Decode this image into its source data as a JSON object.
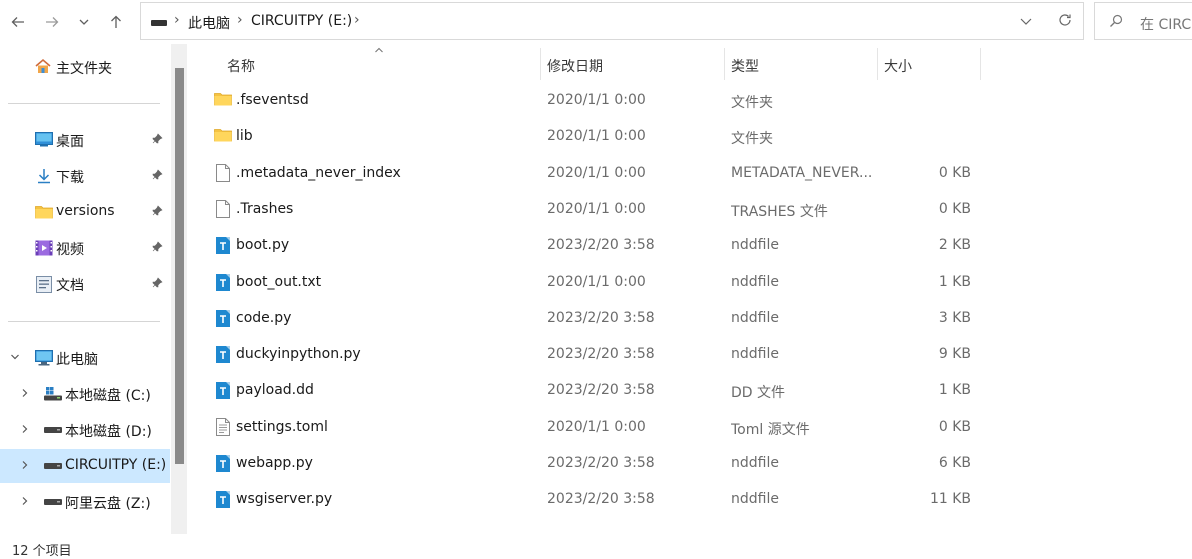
{
  "address": {
    "crumbs": [
      "此电脑",
      "CIRCUITPY (E:)"
    ],
    "separator": "›"
  },
  "search": {
    "placeholder": "在 CIRCUITPY (E:) 中搜索",
    "visible_text": "在 CIRCU"
  },
  "sidebar": {
    "home": "主文件夹",
    "quick_access": [
      {
        "label": "桌面",
        "icon": "desktop-icon"
      },
      {
        "label": "下载",
        "icon": "download-icon"
      },
      {
        "label": "versions",
        "icon": "folder-icon"
      },
      {
        "label": "视频",
        "icon": "video-icon"
      },
      {
        "label": "文档",
        "icon": "document-icon"
      }
    ],
    "this_pc": "此电脑",
    "drives": [
      {
        "label": "本地磁盘 (C:)",
        "icon": "windows-drive-icon"
      },
      {
        "label": "本地磁盘 (D:)",
        "icon": "drive-icon"
      },
      {
        "label": "CIRCUITPY (E:)",
        "icon": "drive-icon",
        "selected": true
      },
      {
        "label": "阿里云盘 (Z:)",
        "icon": "drive-icon"
      }
    ]
  },
  "columns": {
    "name": "名称",
    "date": "修改日期",
    "type": "类型",
    "size": "大小"
  },
  "files": [
    {
      "name": ".fseventsd",
      "date": "2020/1/1 0:00",
      "type": "文件夹",
      "size": "",
      "icon": "folder"
    },
    {
      "name": "lib",
      "date": "2020/1/1 0:00",
      "type": "文件夹",
      "size": "",
      "icon": "folder"
    },
    {
      "name": ".metadata_never_index",
      "date": "2020/1/1 0:00",
      "type": "METADATA_NEVER...",
      "size": "0 KB",
      "icon": "blank"
    },
    {
      "name": ".Trashes",
      "date": "2020/1/1 0:00",
      "type": "TRASHES 文件",
      "size": "0 KB",
      "icon": "blank"
    },
    {
      "name": "boot.py",
      "date": "2023/2/20 3:58",
      "type": "nddfile",
      "size": "2 KB",
      "icon": "ndd"
    },
    {
      "name": "boot_out.txt",
      "date": "2020/1/1 0:00",
      "type": "nddfile",
      "size": "1 KB",
      "icon": "ndd"
    },
    {
      "name": "code.py",
      "date": "2023/2/20 3:58",
      "type": "nddfile",
      "size": "3 KB",
      "icon": "ndd"
    },
    {
      "name": "duckyinpython.py",
      "date": "2023/2/20 3:58",
      "type": "nddfile",
      "size": "9 KB",
      "icon": "ndd"
    },
    {
      "name": "payload.dd",
      "date": "2023/2/20 3:58",
      "type": "DD 文件",
      "size": "1 KB",
      "icon": "ndd"
    },
    {
      "name": "settings.toml",
      "date": "2020/1/1 0:00",
      "type": "Toml 源文件",
      "size": "0 KB",
      "icon": "text"
    },
    {
      "name": "webapp.py",
      "date": "2023/2/20 3:58",
      "type": "nddfile",
      "size": "6 KB",
      "icon": "ndd"
    },
    {
      "name": "wsgiserver.py",
      "date": "2023/2/20 3:58",
      "type": "nddfile",
      "size": "11 KB",
      "icon": "ndd"
    }
  ],
  "status": {
    "item_count": "12 个项目"
  },
  "colors": {
    "selected": "#cce8ff",
    "folder": "#f5c342",
    "ndd_icon": "#1e88d0"
  }
}
